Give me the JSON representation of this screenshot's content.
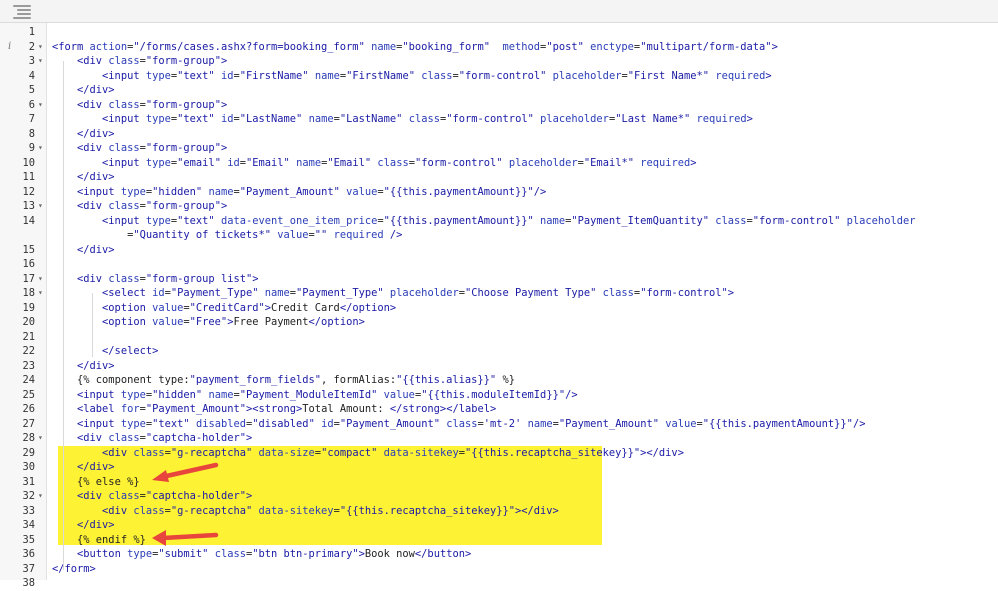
{
  "editor": {
    "toolbar": {
      "menu_icon": "hamburger-menu-icon"
    },
    "gutter": {
      "info_icon": "i",
      "info_line": 2
    },
    "highlight": {
      "color": "#fef234",
      "from_line": 31,
      "to_line": 35
    },
    "arrows": {
      "color": "#e8453c",
      "lines": [
        31,
        35
      ]
    },
    "lines": [
      {
        "n": "1",
        "fold": false,
        "html": ""
      },
      {
        "n": "2",
        "fold": true,
        "html": "<span class=\"k\">&lt;form</span> <span class=\"a\">action</span>=<span class=\"s\">\"/forms/cases.ashx?form=booking_form\"</span> <span class=\"a\">name</span>=<span class=\"s\">\"booking_form\"</span>  <span class=\"a\">method</span>=<span class=\"s\">\"post\"</span> <span class=\"a\">enctype</span>=<span class=\"s\">\"multipart/form-data\"</span><span class=\"k\">&gt;</span>"
      },
      {
        "n": "3",
        "fold": true,
        "html": "    <span class=\"k\">&lt;div</span> <span class=\"a\">class</span>=<span class=\"s\">\"form-group\"</span><span class=\"k\">&gt;</span>"
      },
      {
        "n": "4",
        "fold": false,
        "html": "        <span class=\"k\">&lt;input</span> <span class=\"a\">type</span>=<span class=\"s\">\"text\"</span> <span class=\"a\">id</span>=<span class=\"s\">\"FirstName\"</span> <span class=\"a\">name</span>=<span class=\"s\">\"FirstName\"</span> <span class=\"a\">class</span>=<span class=\"s\">\"form-control\"</span> <span class=\"a\">placeholder</span>=<span class=\"s\">\"First Name*\"</span> <span class=\"a\">required</span><span class=\"k\">&gt;</span>"
      },
      {
        "n": "5",
        "fold": false,
        "html": "    <span class=\"k\">&lt;/div&gt;</span>"
      },
      {
        "n": "6",
        "fold": true,
        "html": "    <span class=\"k\">&lt;div</span> <span class=\"a\">class</span>=<span class=\"s\">\"form-group\"</span><span class=\"k\">&gt;</span>"
      },
      {
        "n": "7",
        "fold": false,
        "html": "        <span class=\"k\">&lt;input</span> <span class=\"a\">type</span>=<span class=\"s\">\"text\"</span> <span class=\"a\">id</span>=<span class=\"s\">\"LastName\"</span> <span class=\"a\">name</span>=<span class=\"s\">\"LastName\"</span> <span class=\"a\">class</span>=<span class=\"s\">\"form-control\"</span> <span class=\"a\">placeholder</span>=<span class=\"s\">\"Last Name*\"</span> <span class=\"a\">required</span><span class=\"k\">&gt;</span>"
      },
      {
        "n": "8",
        "fold": false,
        "html": "    <span class=\"k\">&lt;/div&gt;</span>"
      },
      {
        "n": "9",
        "fold": true,
        "html": "    <span class=\"k\">&lt;div</span> <span class=\"a\">class</span>=<span class=\"s\">\"form-group\"</span><span class=\"k\">&gt;</span>"
      },
      {
        "n": "10",
        "fold": false,
        "html": "        <span class=\"k\">&lt;input</span> <span class=\"a\">type</span>=<span class=\"s\">\"email\"</span> <span class=\"a\">id</span>=<span class=\"s\">\"Email\"</span> <span class=\"a\">name</span>=<span class=\"s\">\"Email\"</span> <span class=\"a\">class</span>=<span class=\"s\">\"form-control\"</span> <span class=\"a\">placeholder</span>=<span class=\"s\">\"Email*\"</span> <span class=\"a\">required</span><span class=\"k\">&gt;</span>"
      },
      {
        "n": "11",
        "fold": false,
        "html": "    <span class=\"k\">&lt;/div&gt;</span>"
      },
      {
        "n": "12",
        "fold": false,
        "html": "    <span class=\"k\">&lt;input</span> <span class=\"a\">type</span>=<span class=\"s\">\"hidden\"</span> <span class=\"a\">name</span>=<span class=\"s\">\"Payment_Amount\"</span> <span class=\"a\">value</span>=<span class=\"s\">\"{{this.paymentAmount}}\"</span><span class=\"k\">/&gt;</span>"
      },
      {
        "n": "13",
        "fold": true,
        "html": "    <span class=\"k\">&lt;div</span> <span class=\"a\">class</span>=<span class=\"s\">\"form-group\"</span><span class=\"k\">&gt;</span>"
      },
      {
        "n": "14",
        "fold": false,
        "html": "        <span class=\"k\">&lt;input</span> <span class=\"a\">type</span>=<span class=\"s\">\"text\"</span> <span class=\"a\">data-event_one_item_price</span>=<span class=\"s\">\"{{this.paymentAmount}}\"</span> <span class=\"a\">name</span>=<span class=\"s\">\"Payment_ItemQuantity\"</span> <span class=\"a\">class</span>=<span class=\"s\">\"form-control\"</span> <span class=\"a\">placeholder</span>"
      },
      {
        "n": "",
        "fold": false,
        "html": "            =<span class=\"s\">\"Quantity of tickets*\"</span> <span class=\"a\">value</span>=<span class=\"s\">\"\"</span> <span class=\"a\">required</span> <span class=\"k\">/&gt;</span>"
      },
      {
        "n": "15",
        "fold": false,
        "html": "    <span class=\"k\">&lt;/div&gt;</span>"
      },
      {
        "n": "16",
        "fold": false,
        "html": ""
      },
      {
        "n": "17",
        "fold": true,
        "html": "    <span class=\"k\">&lt;div</span> <span class=\"a\">class</span>=<span class=\"s\">\"form-group list\"</span><span class=\"k\">&gt;</span>"
      },
      {
        "n": "18",
        "fold": true,
        "html": "        <span class=\"k\">&lt;select</span> <span class=\"a\">id</span>=<span class=\"s\">\"Payment_Type\"</span> <span class=\"a\">name</span>=<span class=\"s\">\"Payment_Type\"</span> <span class=\"a\">placeholder</span>=<span class=\"s\">\"Choose Payment Type\"</span> <span class=\"a\">class</span>=<span class=\"s\">\"form-control\"</span><span class=\"k\">&gt;</span>"
      },
      {
        "n": "19",
        "fold": false,
        "html": "        <span class=\"k\">&lt;option</span> <span class=\"a\">value</span>=<span class=\"s\">\"CreditCard\"</span><span class=\"k\">&gt;</span><span class=\"t\">Credit Card</span><span class=\"k\">&lt;/option&gt;</span>"
      },
      {
        "n": "20",
        "fold": false,
        "html": "        <span class=\"k\">&lt;option</span> <span class=\"a\">value</span>=<span class=\"s\">\"Free\"</span><span class=\"k\">&gt;</span><span class=\"t\">Free Payment</span><span class=\"k\">&lt;/option&gt;</span>"
      },
      {
        "n": "21",
        "fold": false,
        "html": ""
      },
      {
        "n": "22",
        "fold": false,
        "html": "        <span class=\"k\">&lt;/select&gt;</span>"
      },
      {
        "n": "23",
        "fold": false,
        "html": "    <span class=\"k\">&lt;/div&gt;</span>"
      },
      {
        "n": "24",
        "fold": false,
        "html": "    <span class=\"t\">{% component type:</span><span class=\"s\">\"payment_form_fields\"</span><span class=\"t\">, formAlias:</span><span class=\"s\">\"{{this.alias}}\"</span><span class=\"t\"> %}</span>"
      },
      {
        "n": "25",
        "fold": false,
        "html": "    <span class=\"k\">&lt;input</span> <span class=\"a\">type</span>=<span class=\"s\">\"hidden\"</span> <span class=\"a\">name</span>=<span class=\"s\">\"Payment_ModuleItemId\"</span> <span class=\"a\">value</span>=<span class=\"s\">\"{{this.moduleItemId}}\"</span><span class=\"k\">/&gt;</span>"
      },
      {
        "n": "26",
        "fold": false,
        "html": "    <span class=\"k\">&lt;label</span> <span class=\"a\">for</span>=<span class=\"s\">\"Payment_Amount\"</span><span class=\"k\">&gt;&lt;strong&gt;</span><span class=\"t\">Total Amount: </span><span class=\"k\">&lt;/strong&gt;&lt;/label&gt;</span>"
      },
      {
        "n": "27",
        "fold": false,
        "html": "    <span class=\"k\">&lt;input</span> <span class=\"a\">type</span>=<span class=\"s\">\"text\"</span> <span class=\"a\">disabled</span>=<span class=\"s\">\"disabled\"</span> <span class=\"a\">id</span>=<span class=\"s\">\"Payment_Amount\"</span> <span class=\"a\">class</span>=<span class=\"s\">'mt-2'</span> <span class=\"a\">name</span>=<span class=\"s\">\"Payment_Amount\"</span> <span class=\"a\">value</span>=<span class=\"s\">\"{{this.paymentAmount}}\"</span><span class=\"k\">/&gt;</span>"
      },
      {
        "n": "28",
        "fold": true,
        "html": "    <span class=\"k\">&lt;div</span> <span class=\"a\">class</span>=<span class=\"s\">\"captcha-holder\"</span><span class=\"k\">&gt;</span>"
      },
      {
        "n": "29",
        "fold": false,
        "html": "        <span class=\"k\">&lt;div</span> <span class=\"a\">class</span>=<span class=\"s\">\"g-recaptcha\"</span> <span class=\"a\">data-size</span>=<span class=\"s\">\"compact\"</span> <span class=\"a\">data-sitekey</span>=<span class=\"s\">\"{{this.recaptcha_sitekey}}\"</span><span class=\"k\">&gt;&lt;/div&gt;</span>"
      },
      {
        "n": "30",
        "fold": false,
        "html": "    <span class=\"k\">&lt;/div&gt;</span>"
      },
      {
        "n": "31",
        "fold": false,
        "html": "    <span class=\"t\">{% else %}</span>"
      },
      {
        "n": "32",
        "fold": true,
        "html": "    <span class=\"k\">&lt;div</span> <span class=\"a\">class</span>=<span class=\"s\">\"captcha-holder\"</span><span class=\"k\">&gt;</span>"
      },
      {
        "n": "33",
        "fold": false,
        "html": "        <span class=\"k\">&lt;div</span> <span class=\"a\">class</span>=<span class=\"s\">\"g-recaptcha\"</span> <span class=\"a\">data-sitekey</span>=<span class=\"s\">\"{{this.recaptcha_sitekey}}\"</span><span class=\"k\">&gt;&lt;/div&gt;</span>"
      },
      {
        "n": "34",
        "fold": false,
        "html": "    <span class=\"k\">&lt;/div&gt;</span>"
      },
      {
        "n": "35",
        "fold": false,
        "html": "    <span class=\"t\">{% endif %}</span>"
      },
      {
        "n": "36",
        "fold": false,
        "html": "    <span class=\"k\">&lt;button</span> <span class=\"a\">type</span>=<span class=\"s\">\"submit\"</span> <span class=\"a\">class</span>=<span class=\"s\">\"btn btn-primary\"</span><span class=\"k\">&gt;</span><span class=\"t\">Book now</span><span class=\"k\">&lt;/button&gt;</span>"
      },
      {
        "n": "37",
        "fold": false,
        "html": "<span class=\"k\">&lt;/form&gt;</span>"
      },
      {
        "n": "38",
        "fold": false,
        "html": ""
      }
    ]
  }
}
